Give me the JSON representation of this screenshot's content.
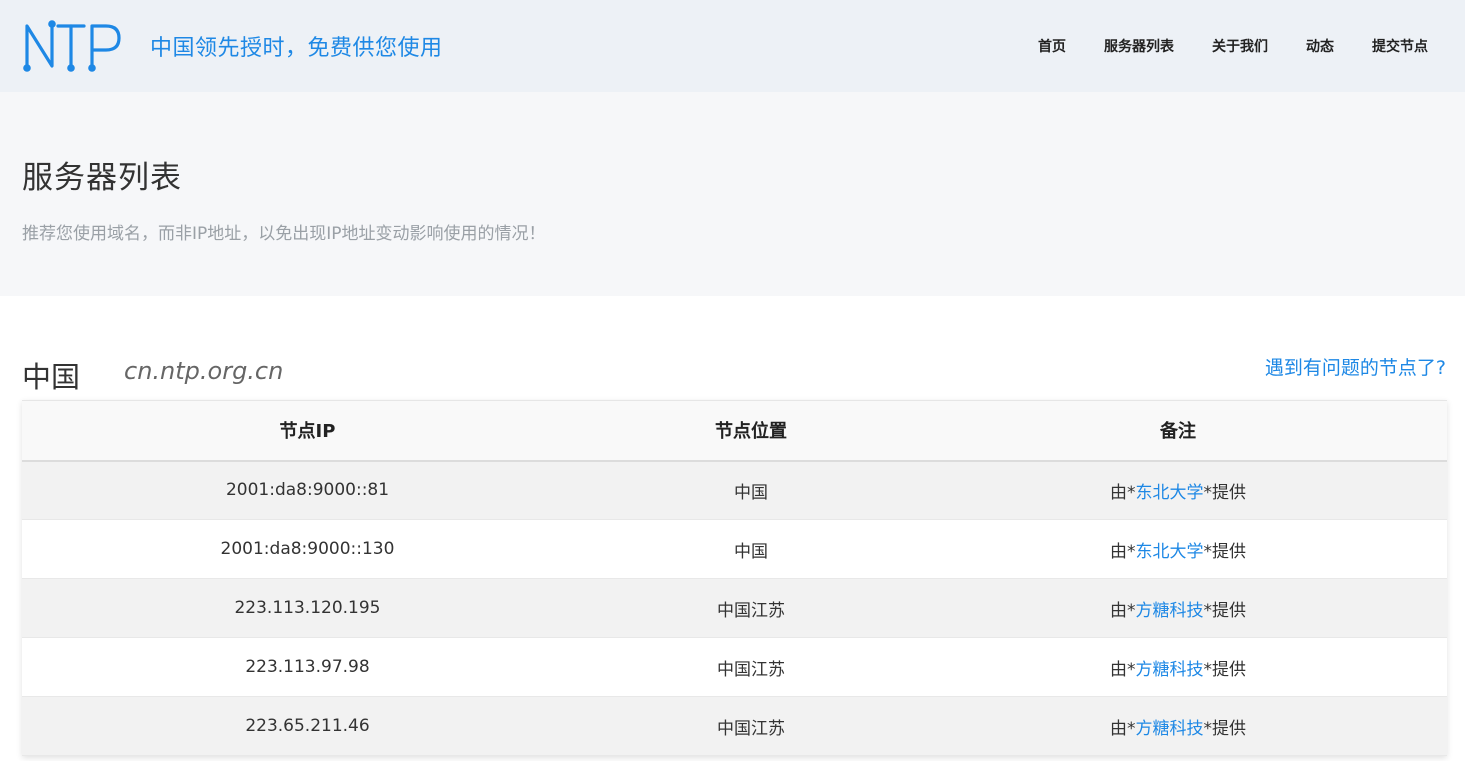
{
  "header": {
    "logo_text": "NTP",
    "slogan": "中国领先授时，免费供您使用",
    "nav": [
      {
        "label": "首页"
      },
      {
        "label": "服务器列表"
      },
      {
        "label": "关于我们"
      },
      {
        "label": "动态"
      },
      {
        "label": "提交节点"
      }
    ],
    "accent_color": "#1e88e5"
  },
  "hero": {
    "title": "服务器列表",
    "subtitle": "推荐您使用域名，而非IP地址，以免出现IP地址变动影响使用的情况！"
  },
  "section": {
    "region": "中国",
    "domain": "cn.ntp.org.cn",
    "report_link": "遇到有问题的节点了?"
  },
  "table": {
    "headers": [
      "节点IP",
      "节点位置",
      "备注"
    ],
    "rows": [
      {
        "ip": "2001:da8:9000::81",
        "location": "中国",
        "note_prefix": "由*",
        "provider": "东北大学",
        "note_suffix": "*提供"
      },
      {
        "ip": "2001:da8:9000::130",
        "location": "中国",
        "note_prefix": "由*",
        "provider": "东北大学",
        "note_suffix": "*提供"
      },
      {
        "ip": "223.113.120.195",
        "location": "中国江苏",
        "note_prefix": "由*",
        "provider": "方糖科技",
        "note_suffix": "*提供"
      },
      {
        "ip": "223.113.97.98",
        "location": "中国江苏",
        "note_prefix": "由*",
        "provider": "方糖科技",
        "note_suffix": "*提供"
      },
      {
        "ip": "223.65.211.46",
        "location": "中国江苏",
        "note_prefix": "由*",
        "provider": "方糖科技",
        "note_suffix": "*提供"
      }
    ]
  }
}
